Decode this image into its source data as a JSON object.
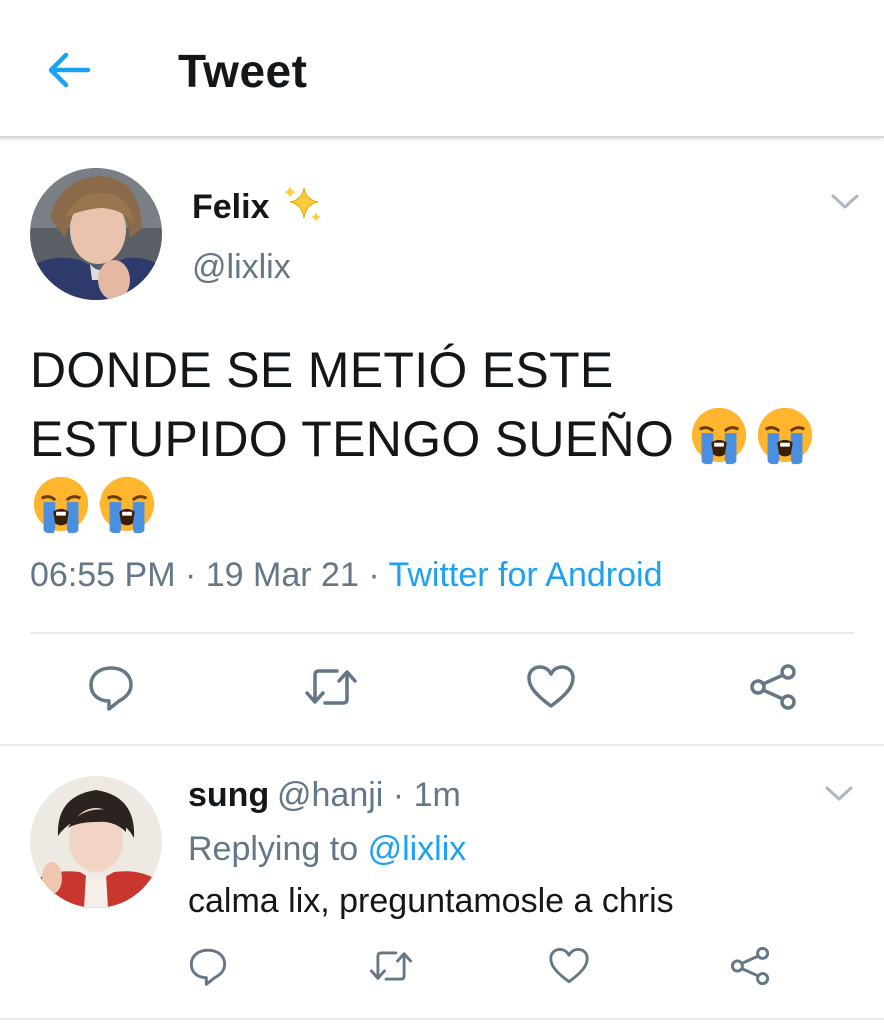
{
  "header": {
    "title": "Tweet",
    "back_icon": "arrow-left-icon"
  },
  "tweet": {
    "author_name": "Felix",
    "author_badge_icon": "sparkles-icon",
    "author_handle": "@lixlix",
    "text_line1": "DONDE SE METIÓ ESTE",
    "text_line2": "ESTUPIDO TENGO SUEÑO",
    "emoji": "loudly-crying-face",
    "timestamp": "06:55 PM",
    "date": "19 Mar 21",
    "source": "Twitter for Android",
    "separator": "·"
  },
  "actions": [
    "reply-icon",
    "retweet-icon",
    "like-icon",
    "share-icon"
  ],
  "reply": {
    "author_name": "sung",
    "author_handle": "@hanji · 1m",
    "replying_prefix": "Replying to",
    "replying_handle": "@lixlix",
    "text": "calma lix, preguntamosle a chris"
  },
  "colors": {
    "accent": "#1da1f2",
    "secondary_text": "#657786",
    "icon": "#657786",
    "divider": "#e6ecf0"
  }
}
